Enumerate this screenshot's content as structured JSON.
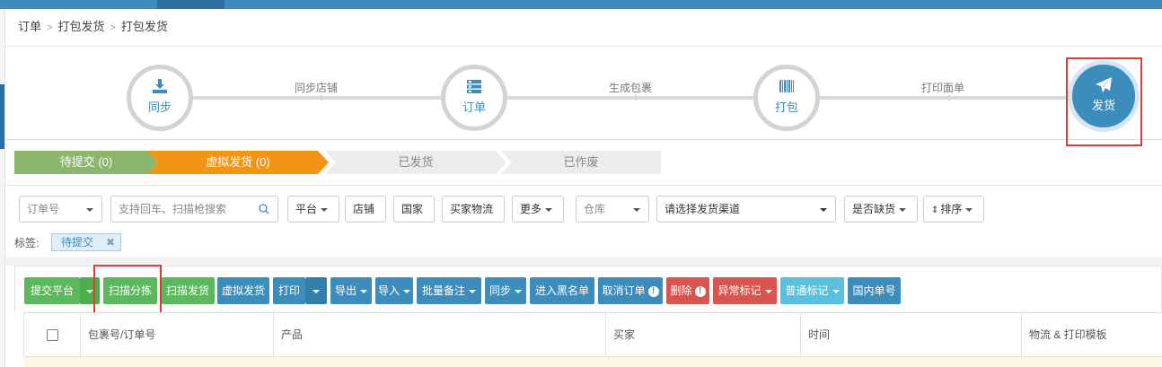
{
  "breadcrumb": [
    "订单",
    "打包发货",
    "打包发货"
  ],
  "flow": {
    "steps": [
      {
        "label": "同步",
        "icon": "download-icon"
      },
      {
        "label": "订单",
        "icon": "list-icon"
      },
      {
        "label": "打包",
        "icon": "barcode-icon"
      },
      {
        "label": "发货",
        "icon": "paper-plane-icon",
        "active": true
      }
    ],
    "connectors": [
      "同步店铺",
      "生成包裹",
      "打印面单"
    ]
  },
  "status_tabs": [
    {
      "label": "待提交 (0)",
      "color": "#8cb56e"
    },
    {
      "label": "虚拟发货 (0)",
      "color": "#f39415"
    },
    {
      "label": "已发货",
      "color": "#ececec"
    },
    {
      "label": "已作废",
      "color": "#ececec"
    }
  ],
  "filters": {
    "order_select": "订单号",
    "search_placeholder": "支持回车、扫描枪搜索",
    "platform": "平台",
    "shop": "店铺",
    "country": "国家",
    "buyer_logistics": "买家物流",
    "more": "更多",
    "warehouse": "仓库",
    "channel": "请选择发货渠道",
    "out_of_stock": "是否缺货",
    "sort": "排序",
    "tag_label": "标签:",
    "tag": "待提交"
  },
  "actions": {
    "submit_platform": "提交平台",
    "scan_sort": "扫描分拣",
    "scan_ship": "扫描发货",
    "virtual_ship": "虚拟发货",
    "print": "打印",
    "export": "导出",
    "import": "导入",
    "batch_note": "批量备注",
    "sync": "同步",
    "blacklist": "进入黑名单",
    "cancel_order": "取消订单",
    "delete": "删除",
    "abnormal_mark": "异常标记",
    "normal_mark": "普通标记",
    "domestic_no": "国内单号"
  },
  "table": {
    "columns": [
      "包裹号/订单号",
      "产品",
      "买家",
      "时间",
      "物流 & 打印模板"
    ]
  },
  "colors": {
    "primary": "#3c8dbc",
    "green": "#5cb85c",
    "red": "#d9534f",
    "cyan": "#5bc0de",
    "highlight": "#e53935"
  }
}
